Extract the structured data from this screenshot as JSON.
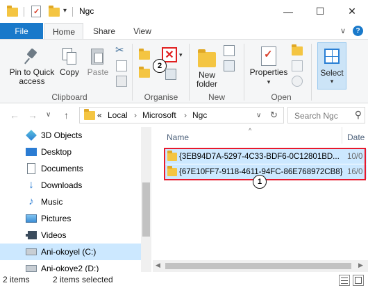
{
  "window": {
    "title": "Ngc",
    "minimize_glyph": "—",
    "maximize_glyph": "☐",
    "close_glyph": "✕"
  },
  "tabs": {
    "file": "File",
    "home": "Home",
    "share": "Share",
    "view": "View",
    "help_glyph": "?",
    "expand_glyph": "∨"
  },
  "ribbon": {
    "clipboard": {
      "pin_label": "Pin to Quick access",
      "copy_label": "Copy",
      "paste_label": "Paste",
      "group_label": "Clipboard"
    },
    "organise": {
      "group_label": "Organise",
      "delete_glyph": "✕",
      "annotation": "2"
    },
    "new": {
      "new_folder_label": "New folder",
      "group_label": "New"
    },
    "open": {
      "properties_label": "Properties",
      "group_label": "Open"
    },
    "select": {
      "select_label": "Select"
    }
  },
  "address": {
    "back_glyph": "←",
    "forward_glyph": "→",
    "recent_glyph": "∨",
    "up_glyph": "↑",
    "overflow": "«",
    "segments": [
      "Local",
      "Microsoft",
      "Ngc"
    ],
    "separator": "›",
    "dropdown_glyph": "∨",
    "refresh_glyph": "↻",
    "search_placeholder": "Search Ngc",
    "search_glyph": "⚲"
  },
  "nav_pane": {
    "items": [
      {
        "label": "3D Objects",
        "icon": "3d-objects-icon"
      },
      {
        "label": "Desktop",
        "icon": "desktop-icon"
      },
      {
        "label": "Documents",
        "icon": "documents-icon"
      },
      {
        "label": "Downloads",
        "icon": "downloads-icon"
      },
      {
        "label": "Music",
        "icon": "music-icon"
      },
      {
        "label": "Pictures",
        "icon": "pictures-icon"
      },
      {
        "label": "Videos",
        "icon": "videos-icon"
      },
      {
        "label": "Ani-okoyel (C:)",
        "icon": "drive-icon",
        "selected": true
      },
      {
        "label": "Ani-okoye2 (D:)",
        "icon": "drive-icon"
      }
    ]
  },
  "file_pane": {
    "columns": {
      "name": "Name",
      "date": "Date"
    },
    "sort_glyph": "^",
    "files": [
      {
        "name": "{3EB94D7A-5297-4C33-BDF6-0C12801BD...",
        "date": "10/0"
      },
      {
        "name": "{67E10FF7-9118-4611-94FC-86E768972CB8}",
        "date": "16/0"
      }
    ],
    "annotation": "1"
  },
  "status": {
    "item_count": "2 items",
    "selected_count": "2 items selected"
  },
  "colors": {
    "accent": "#1979ca",
    "selection": "#cce8ff",
    "highlight": "#e8192c",
    "folder": "#f4c542"
  }
}
